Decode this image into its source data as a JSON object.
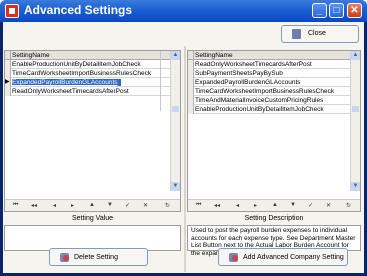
{
  "window": {
    "title": "Advanced Settings",
    "minimize_glyph": "_",
    "maximize_glyph": "□",
    "close_glyph": "✕"
  },
  "toolbar": {
    "close_label": "Close"
  },
  "left_grid": {
    "header": "SettingName",
    "active_marker": "▶",
    "rows": [
      "EnableProductionUnitByDetailItemJobCheck",
      "TimeCardWorksheetImportBusinessRulesCheck",
      "ExpandedPayrollBurdenGLAccounts",
      "ReadOnlyWorksheetTimecardsAfterPost"
    ]
  },
  "right_grid": {
    "header": "SettingName",
    "rows": [
      "ReadOnlyWorksheetTimecardsAfterPost",
      "SubPaymentSheetsPayBySub",
      "ExpandedPayrollBurdenGLAccounts",
      "TimeCardWorksheetImportBusinessRulesCheck",
      "TimeAndMaterialInvoiceCustomPricingRules",
      "EnableProductionUnitByDetailItemJobCheck"
    ]
  },
  "navigator": {
    "first": "⏮",
    "prev_page": "◂◂",
    "prev": "◂",
    "next": "▸",
    "insert": "▲",
    "delete": "▼",
    "edit": "✓",
    "post": "✕",
    "refresh": "↻"
  },
  "scroll": {
    "up": "▲",
    "down": "▼"
  },
  "labels": {
    "setting_value": "Setting Value",
    "setting_description": "Setting Description"
  },
  "description": "Used to post the payroll burden expenses to individual accounts for each expense type.  See Department Master List Button next to the Actual Labor Burden Account for the expanded list of accounts.",
  "buttons": {
    "delete_setting": "Delete Setting",
    "add_advanced": "Add Advanced Company Setting"
  }
}
